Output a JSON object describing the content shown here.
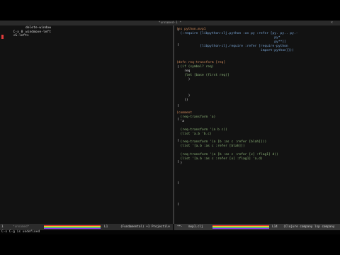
{
  "window": {
    "title": "*unnamed-1 *",
    "close_glyph": "×"
  },
  "left_pane": {
    "lines": [
      {
        "key": "C-x 0",
        "desc": "delete-window"
      },
      {
        "key": "<S-left>",
        "desc": "windmove-left"
      }
    ]
  },
  "right_pane": {
    "code": [
      "(ns python.mvp1",
      "  (:require [libpython-clj.python :as py :refer [py. py.. py.-",
      "                                                  py*",
      "                                                  py**]]",
      "            [libpython-clj.require :refer [require-python",
      "                                           import-python]]))",
      "",
      "",
      "(defn req-transform [req]",
      "  (if (symbol? req)",
      "    req",
      "    (let [base (first req)]",
      "      )",
      "",
      "",
      "",
      "      )",
      "    ))",
      "",
      "",
      "(comment",
      "  (req-transform 'a)",
      "  'a",
      "",
      "  (req-transform '(a b c))",
      "  (list 'a.b 'b.c)",
      "",
      "  (req-transform '(a [b :as c :refer [blah]]))",
      "  (list '[a.b :as c :refer [blah]])",
      "",
      "  (req-transform '(a [b :as c :refer [x] :flag1] d))",
      "  (list '[a.b :as c :refer [x] :flag1] 'a.d)",
      "  )"
    ]
  },
  "modeline_left": {
    "state": "1",
    "buffer": "*unnamed*",
    "position": "L1",
    "project": "(Fundamental) +1 Projectile"
  },
  "modeline_right": {
    "state": "**-",
    "buffer": "mvp1.clj",
    "position": "L14",
    "mode": "(Clojure company lsp company"
  },
  "minibuffer": {
    "message": "C-x C-g is undefined"
  },
  "colors": {
    "background": "#121212",
    "text": "#d6d6d6",
    "keyword": "#d08a5a",
    "accent": "#7aa7d8",
    "cursor": "#e03b3b"
  }
}
